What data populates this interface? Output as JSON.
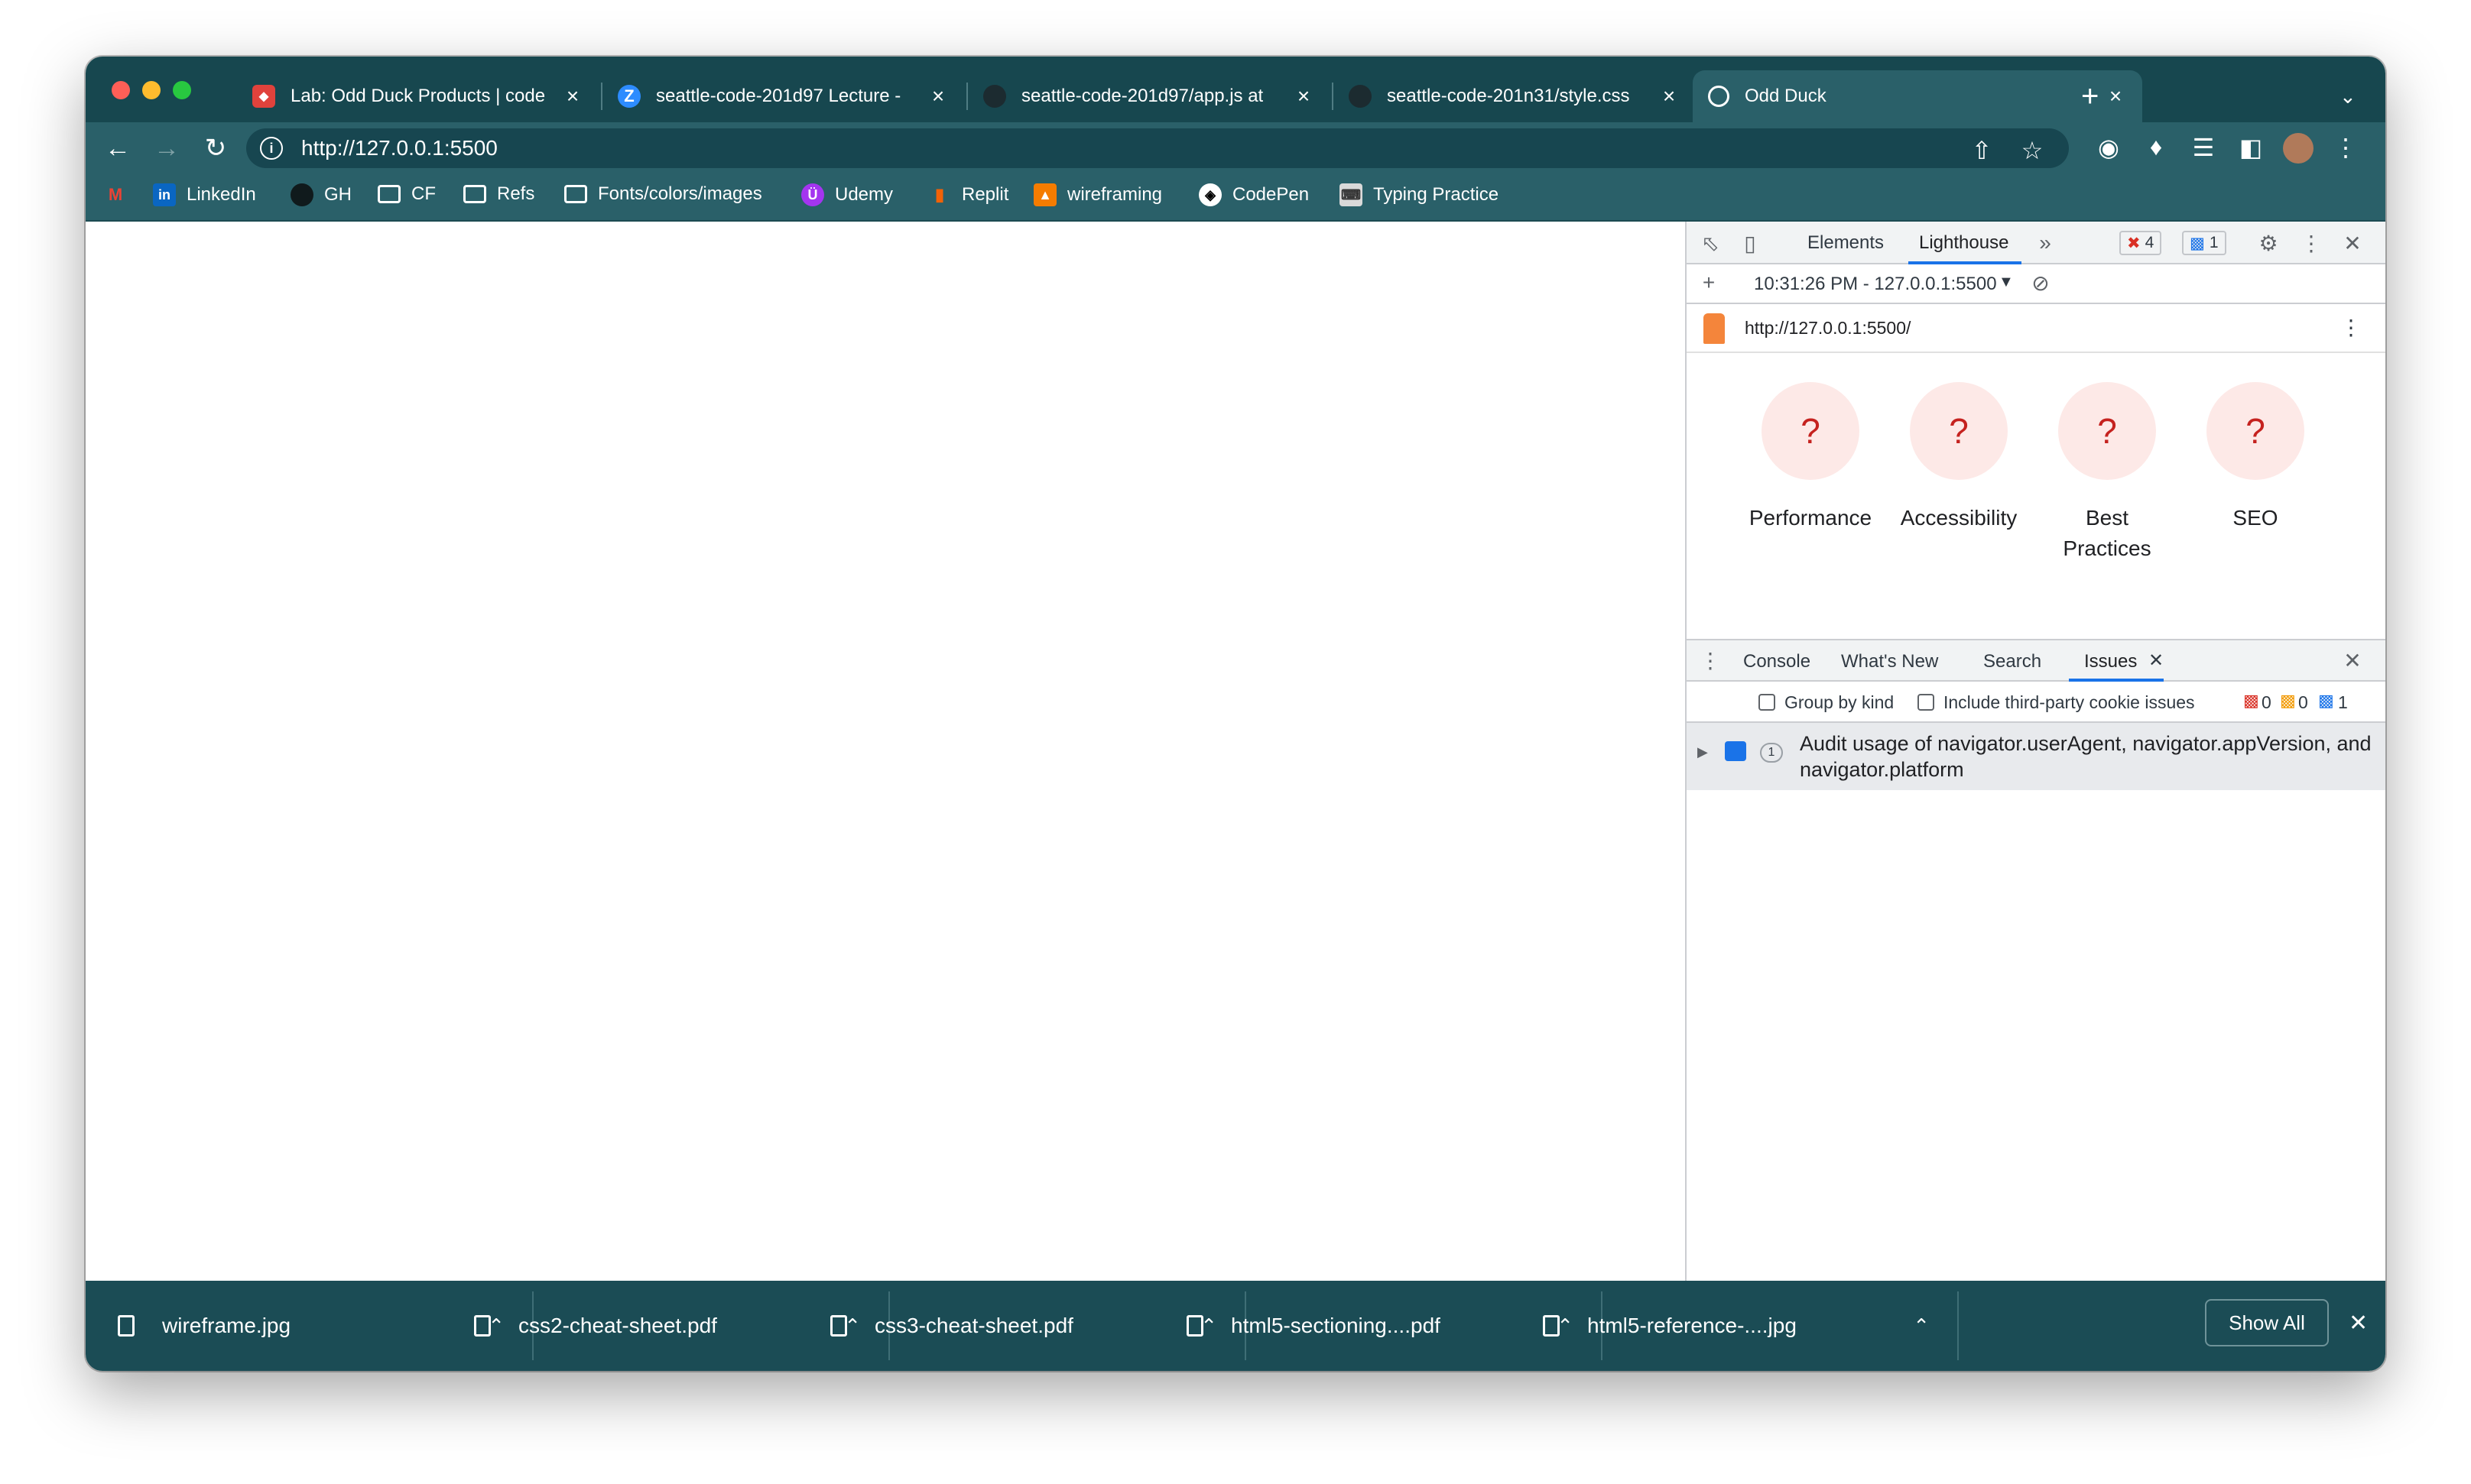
{
  "tabs": [
    {
      "title": "Lab: Odd Duck Products | code",
      "favicon": "codefellows-icon",
      "active": false
    },
    {
      "title": "seattle-code-201d97 Lecture -",
      "favicon": "zoom-icon",
      "active": false
    },
    {
      "title": "seattle-code-201d97/app.js at",
      "favicon": "github-icon",
      "active": false
    },
    {
      "title": "seattle-code-201n31/style.css",
      "favicon": "github-icon",
      "active": false
    },
    {
      "title": "Odd Duck",
      "favicon": "globe-icon",
      "active": true
    }
  ],
  "toolbar": {
    "url": "http://127.0.0.1:5500"
  },
  "bookmarks": [
    {
      "label": "",
      "icon": "gmail-icon"
    },
    {
      "label": "LinkedIn",
      "icon": "linkedin-icon"
    },
    {
      "label": "GH",
      "icon": "github-icon"
    },
    {
      "label": "CF",
      "icon": "folder-icon"
    },
    {
      "label": "Refs",
      "icon": "folder-icon"
    },
    {
      "label": "Fonts/colors/images",
      "icon": "folder-icon"
    },
    {
      "label": "Udemy",
      "icon": "udemy-icon"
    },
    {
      "label": "Replit",
      "icon": "replit-icon"
    },
    {
      "label": "wireframing",
      "icon": "wireframing-icon"
    },
    {
      "label": "CodePen",
      "icon": "codepen-icon"
    },
    {
      "label": "Typing Practice",
      "icon": "typing-icon"
    }
  ],
  "devtools": {
    "tabs": {
      "elements": "Elements",
      "lighthouse": "Lighthouse"
    },
    "error_count": "4",
    "message_count": "1",
    "report_selector": "10:31:26 PM - 127.0.0.1:5500",
    "report_url": "http://127.0.0.1:5500/",
    "gauges": [
      {
        "symbol": "?",
        "label": "Performance"
      },
      {
        "symbol": "?",
        "label": "Accessibility"
      },
      {
        "symbol": "?",
        "label": "Best Practices"
      },
      {
        "symbol": "?",
        "label": "SEO"
      }
    ],
    "drawer_tabs": {
      "console": "Console",
      "whats_new": "What's New",
      "search": "Search",
      "issues": "Issues"
    },
    "filters": {
      "group_by_kind": "Group by kind",
      "third_party": "Include third-party cookie issues"
    },
    "issue_counts": {
      "errors": "0",
      "warnings": "0",
      "info": "1"
    },
    "issue": {
      "count": "1",
      "text": "Audit usage of navigator.userAgent, navigator.appVersion, and navigator.platform"
    }
  },
  "downloads": {
    "items": [
      {
        "name": "wireframe.jpg"
      },
      {
        "name": "css2-cheat-sheet.pdf"
      },
      {
        "name": "css3-cheat-sheet.pdf"
      },
      {
        "name": "html5-sectioning....pdf"
      },
      {
        "name": "html5-reference-....jpg"
      }
    ],
    "show_all": "Show All"
  },
  "colors": {
    "frame": "#17474f",
    "toolbar": "#2a6069",
    "downloads_bar": "#1b4c55",
    "gauge_bg": "#fde9e7",
    "gauge_fg": "#c5221f"
  }
}
